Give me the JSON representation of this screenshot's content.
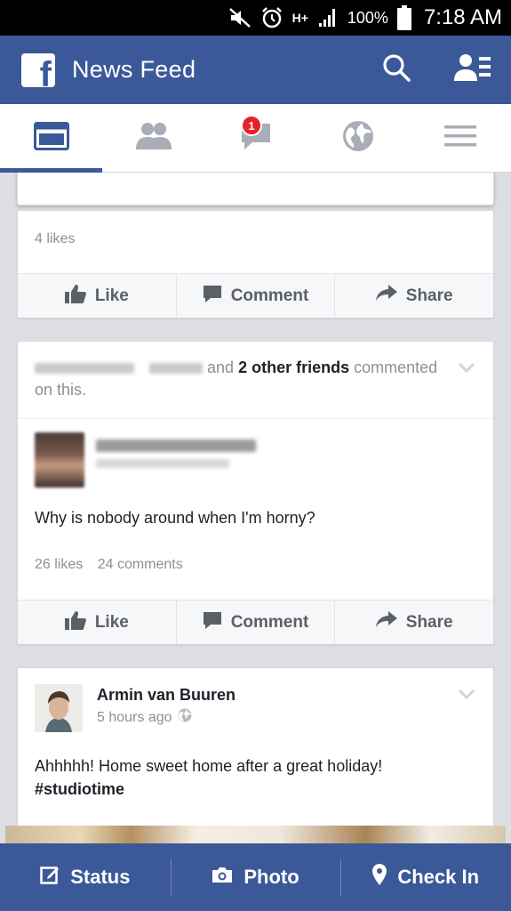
{
  "status_bar": {
    "battery": "100%",
    "time": "7:18 AM",
    "network": "H+"
  },
  "app_bar": {
    "title": "News Feed",
    "logo_letter": "f"
  },
  "tabs": {
    "messages_badge": "1"
  },
  "post1": {
    "likes": "4 likes",
    "actions": {
      "like": "Like",
      "comment": "Comment",
      "share": "Share"
    }
  },
  "post2": {
    "header_and": "and",
    "header_friends": "2 other friends",
    "header_suffix": "commented",
    "header_line2": "on this.",
    "text": "Why is nobody around when I'm horny?",
    "likes": "26 likes",
    "comments": "24 comments",
    "actions": {
      "like": "Like",
      "comment": "Comment",
      "share": "Share"
    }
  },
  "post3": {
    "author": "Armin van Buuren",
    "time": "5 hours ago",
    "text": "Ahhhhh! Home sweet home after a great holiday!",
    "hashtag": "#studiotime"
  },
  "bottom_bar": {
    "status": "Status",
    "photo": "Photo",
    "checkin": "Check In"
  },
  "colors": {
    "brand": "#3b5998",
    "badge": "#e8202a"
  }
}
